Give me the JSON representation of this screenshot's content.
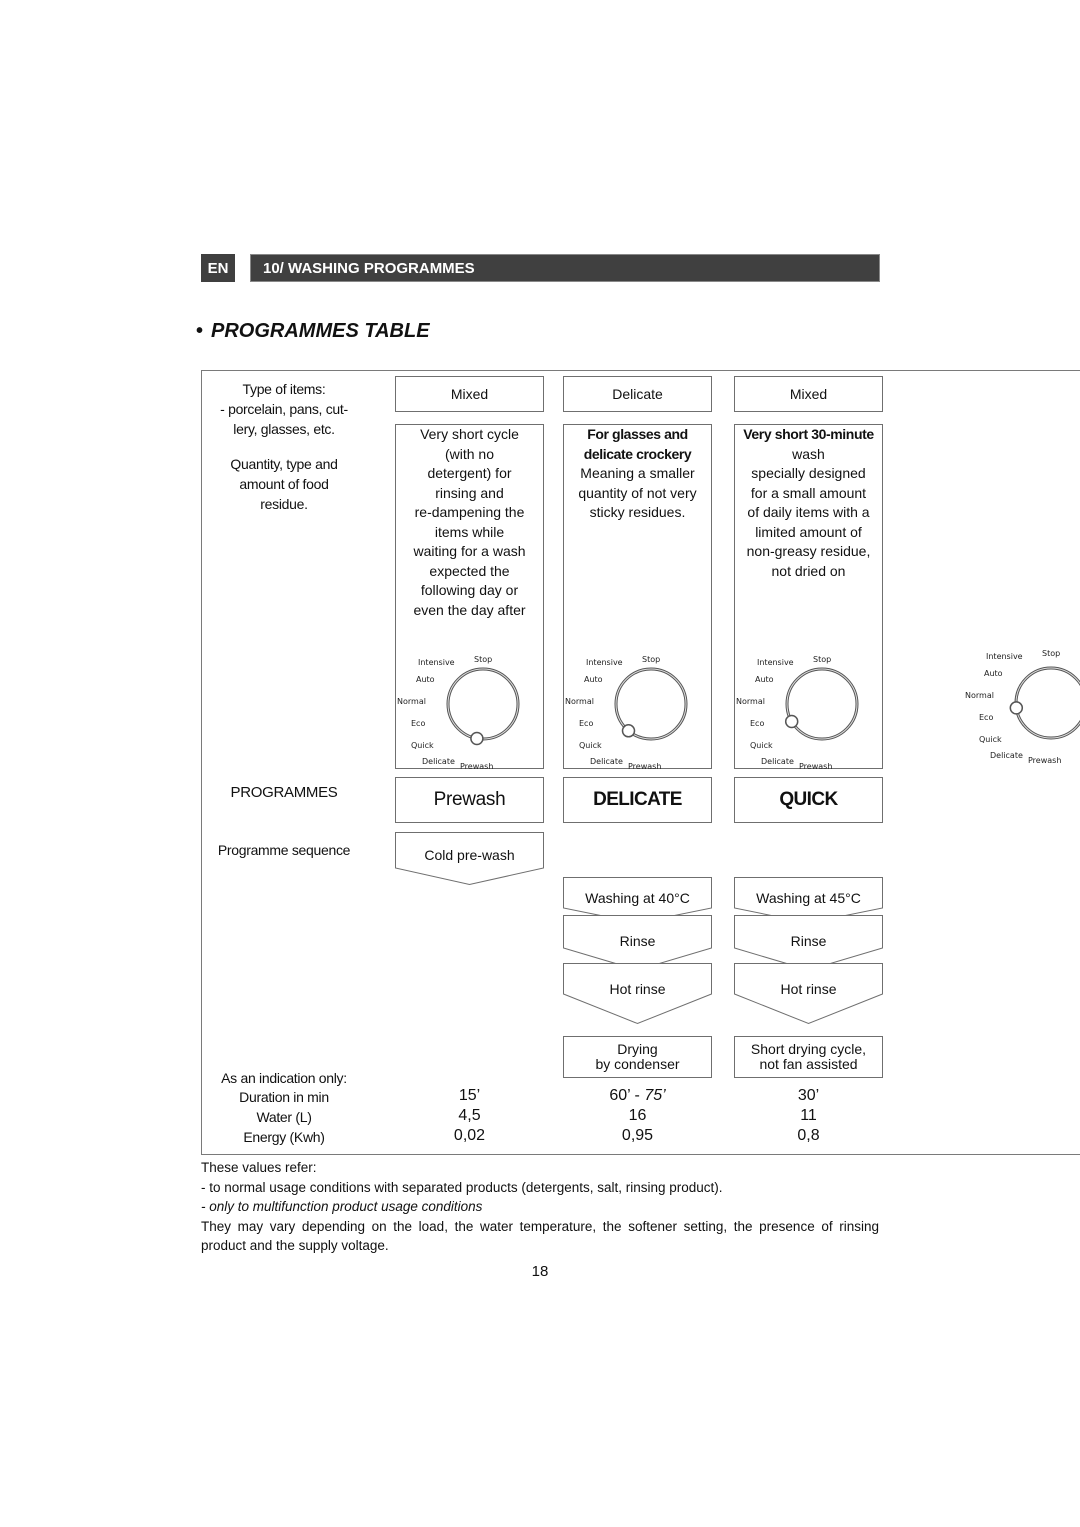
{
  "header": {
    "language": "EN",
    "section": "10/ WASHING PROGRAMMES",
    "colors": {
      "bar": "#404040",
      "text": "#ffffff"
    }
  },
  "title": {
    "bullet": "•",
    "text": "PROGRAMMES TABLE"
  },
  "left_labels": {
    "type_of_items": [
      "Type of items:",
      "- porcelain, pans, cut-",
      "lery, glasses, etc."
    ],
    "quantity": [
      "Quantity, type and",
      "amount of food",
      "residue."
    ],
    "programmes": "PROGRAMMES",
    "sequence": "Programme sequence",
    "indication": "As an indication only:",
    "duration": "Duration in min",
    "water": "Water (L)",
    "energy": "Energy (Kwh)"
  },
  "dial_labels": {
    "intensive": "Intensive",
    "stop": "Stop",
    "auto": "Auto",
    "normal": "Normal",
    "eco": "Eco",
    "quick": "Quick",
    "delicate": "Delicate",
    "prewash": "Prewash"
  },
  "programmes": [
    {
      "type": "Mixed",
      "description_bold": "",
      "description": [
        "Very short cycle",
        "(with no",
        "detergent) for",
        "rinsing and",
        "re-dampening the",
        "items while",
        "waiting for a wash",
        "expected the",
        "following day or",
        "even the day after"
      ],
      "dial_selected": "Prewash",
      "name": "Prewash",
      "steps": [
        "Cold pre-wash"
      ],
      "duration": "15’",
      "duration_alt": "",
      "water": "4,5",
      "energy": "0,02"
    },
    {
      "type": "Delicate",
      "description_bold": [
        "For glasses and",
        "delicate crockery"
      ],
      "description": [
        "Meaning a smaller",
        "quantity of not very",
        "sticky residues."
      ],
      "dial_selected": "Delicate",
      "name": "DELICATE",
      "steps": [
        "Washing at 40°C",
        "Rinse",
        "Hot rinse"
      ],
      "final_step": [
        "Drying",
        "by condenser"
      ],
      "duration": "60’ - ",
      "duration_alt": "75’",
      "water": "16",
      "energy": "0,95"
    },
    {
      "type": "Mixed",
      "description_bold": [
        "Very short 30-minute"
      ],
      "description": [
        "wash",
        "specially designed",
        "for a small amount",
        "of daily items with a",
        "limited amount of",
        "non-greasy residue,",
        "not dried on"
      ],
      "dial_selected": "Quick",
      "name": "QUICK",
      "steps": [
        "Washing at 45°C",
        "Rinse",
        "Hot rinse"
      ],
      "final_step": [
        "Short drying cycle,",
        "not fan assisted"
      ],
      "duration": "30’",
      "duration_alt": "",
      "water": "11",
      "energy": "0,8"
    },
    {
      "dial_selected": "Eco",
      "partial": true
    }
  ],
  "notes": {
    "intro": "These values refer:",
    "line1": "- to normal usage conditions with separated products (detergents, salt, rinsing product).",
    "line2": "- only to multifunction product usage conditions",
    "line3": "They may vary depending on the load, the water temperature, the softener setting, the presence of rinsing product and the supply voltage."
  },
  "page_number": "18"
}
